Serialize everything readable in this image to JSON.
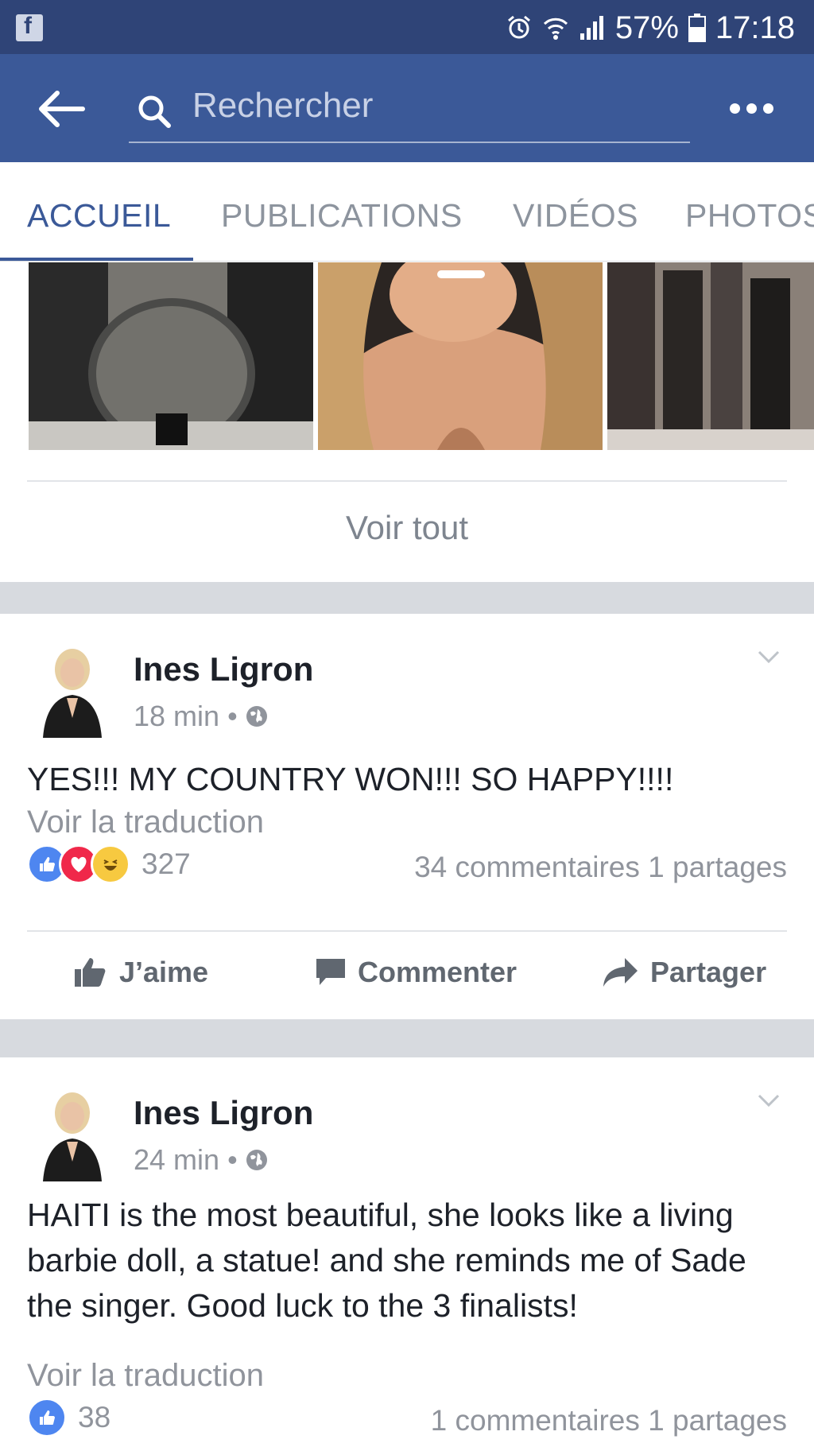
{
  "status_bar": {
    "battery": "57%",
    "time": "17:18"
  },
  "search": {
    "placeholder": "Rechercher"
  },
  "tabs": [
    {
      "label": "ACCUEIL",
      "active": true
    },
    {
      "label": "PUBLICATIONS",
      "active": false
    },
    {
      "label": "VIDÉOS",
      "active": false
    },
    {
      "label": "PHOTOS",
      "active": false
    }
  ],
  "photos_section": {
    "see_all": "Voir tout"
  },
  "posts": [
    {
      "author": "Ines Ligron",
      "time": "18 min",
      "text": "YES!!! MY COUNTRY WON!!! SO HAPPY!!!!",
      "translate": "Voir la traduction",
      "reaction_count": "327",
      "comments": "34 commentaires",
      "shares": "1 partages"
    },
    {
      "author": "Ines Ligron",
      "time": "24 min",
      "text": "HAITI is the most beautiful, she looks like a living barbie doll, a statue! and she reminds me of Sade the singer. Good luck to the 3 finalists!",
      "translate": "Voir la traduction",
      "reaction_count": "38",
      "comments": "1 commentaires",
      "shares": "1 partages"
    }
  ],
  "actions": {
    "like": "J’aime",
    "comment": "Commenter",
    "share": "Partager"
  },
  "colors": {
    "brand": "#3b5998",
    "status_bar": "#2f4477",
    "like": "#4e86f0",
    "love": "#f0284a",
    "haha": "#f7c940"
  }
}
